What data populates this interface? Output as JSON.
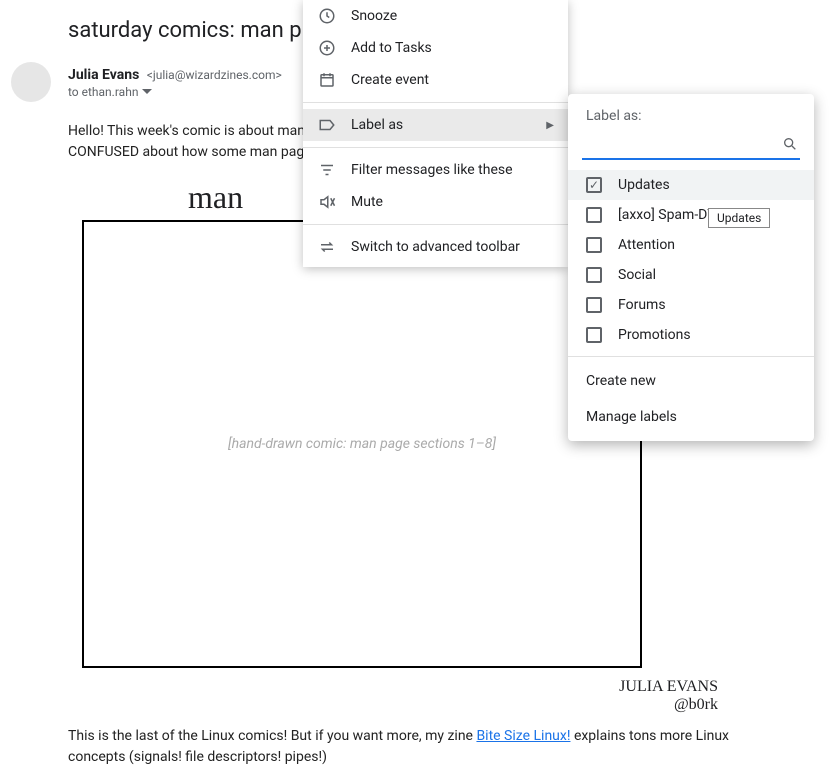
{
  "email": {
    "subject": "saturday comics: man p",
    "sender_name": "Julia Evans",
    "sender_email": "<julia@wizardzines.com>",
    "recipient_line": "to ethan.rahn",
    "body_line1": "Hello! This week's comic is about man p",
    "body_line2": "CONFUSED about how some man page",
    "comic_title": "man",
    "comic_placeholder": "[hand-drawn comic: man page sections 1–8]",
    "signature_line1": "JULIA EVANS",
    "signature_line2": "@b0rk",
    "footer_before_link": "This is the last of the Linux comics! But if you want more, my zine ",
    "footer_link": "Bite Size Linux!",
    "footer_after_link": " explains tons more Linux concepts (signals! file descriptors! pipes!)"
  },
  "context_menu": {
    "items": [
      {
        "icon": "clock",
        "label": "Snooze"
      },
      {
        "icon": "add-task",
        "label": "Add to Tasks"
      },
      {
        "icon": "calendar",
        "label": "Create event"
      }
    ],
    "label_as": "Label as",
    "items2": [
      {
        "icon": "filter",
        "label": "Filter messages like these"
      },
      {
        "icon": "mute",
        "label": "Mute"
      }
    ],
    "items3": [
      {
        "icon": "swap",
        "label": "Switch to advanced toolbar"
      }
    ]
  },
  "label_popup": {
    "title": "Label as:",
    "search_placeholder": "",
    "labels": [
      {
        "name": "Updates",
        "checked": true,
        "selected": true
      },
      {
        "name": "[axxo] Spam-DVDRIP",
        "checked": false
      },
      {
        "name": "Attention",
        "checked": false
      },
      {
        "name": "Social",
        "checked": false
      },
      {
        "name": "Forums",
        "checked": false
      },
      {
        "name": "Promotions",
        "checked": false
      }
    ],
    "create_new": "Create new",
    "manage": "Manage labels"
  },
  "tooltip": "Updates"
}
